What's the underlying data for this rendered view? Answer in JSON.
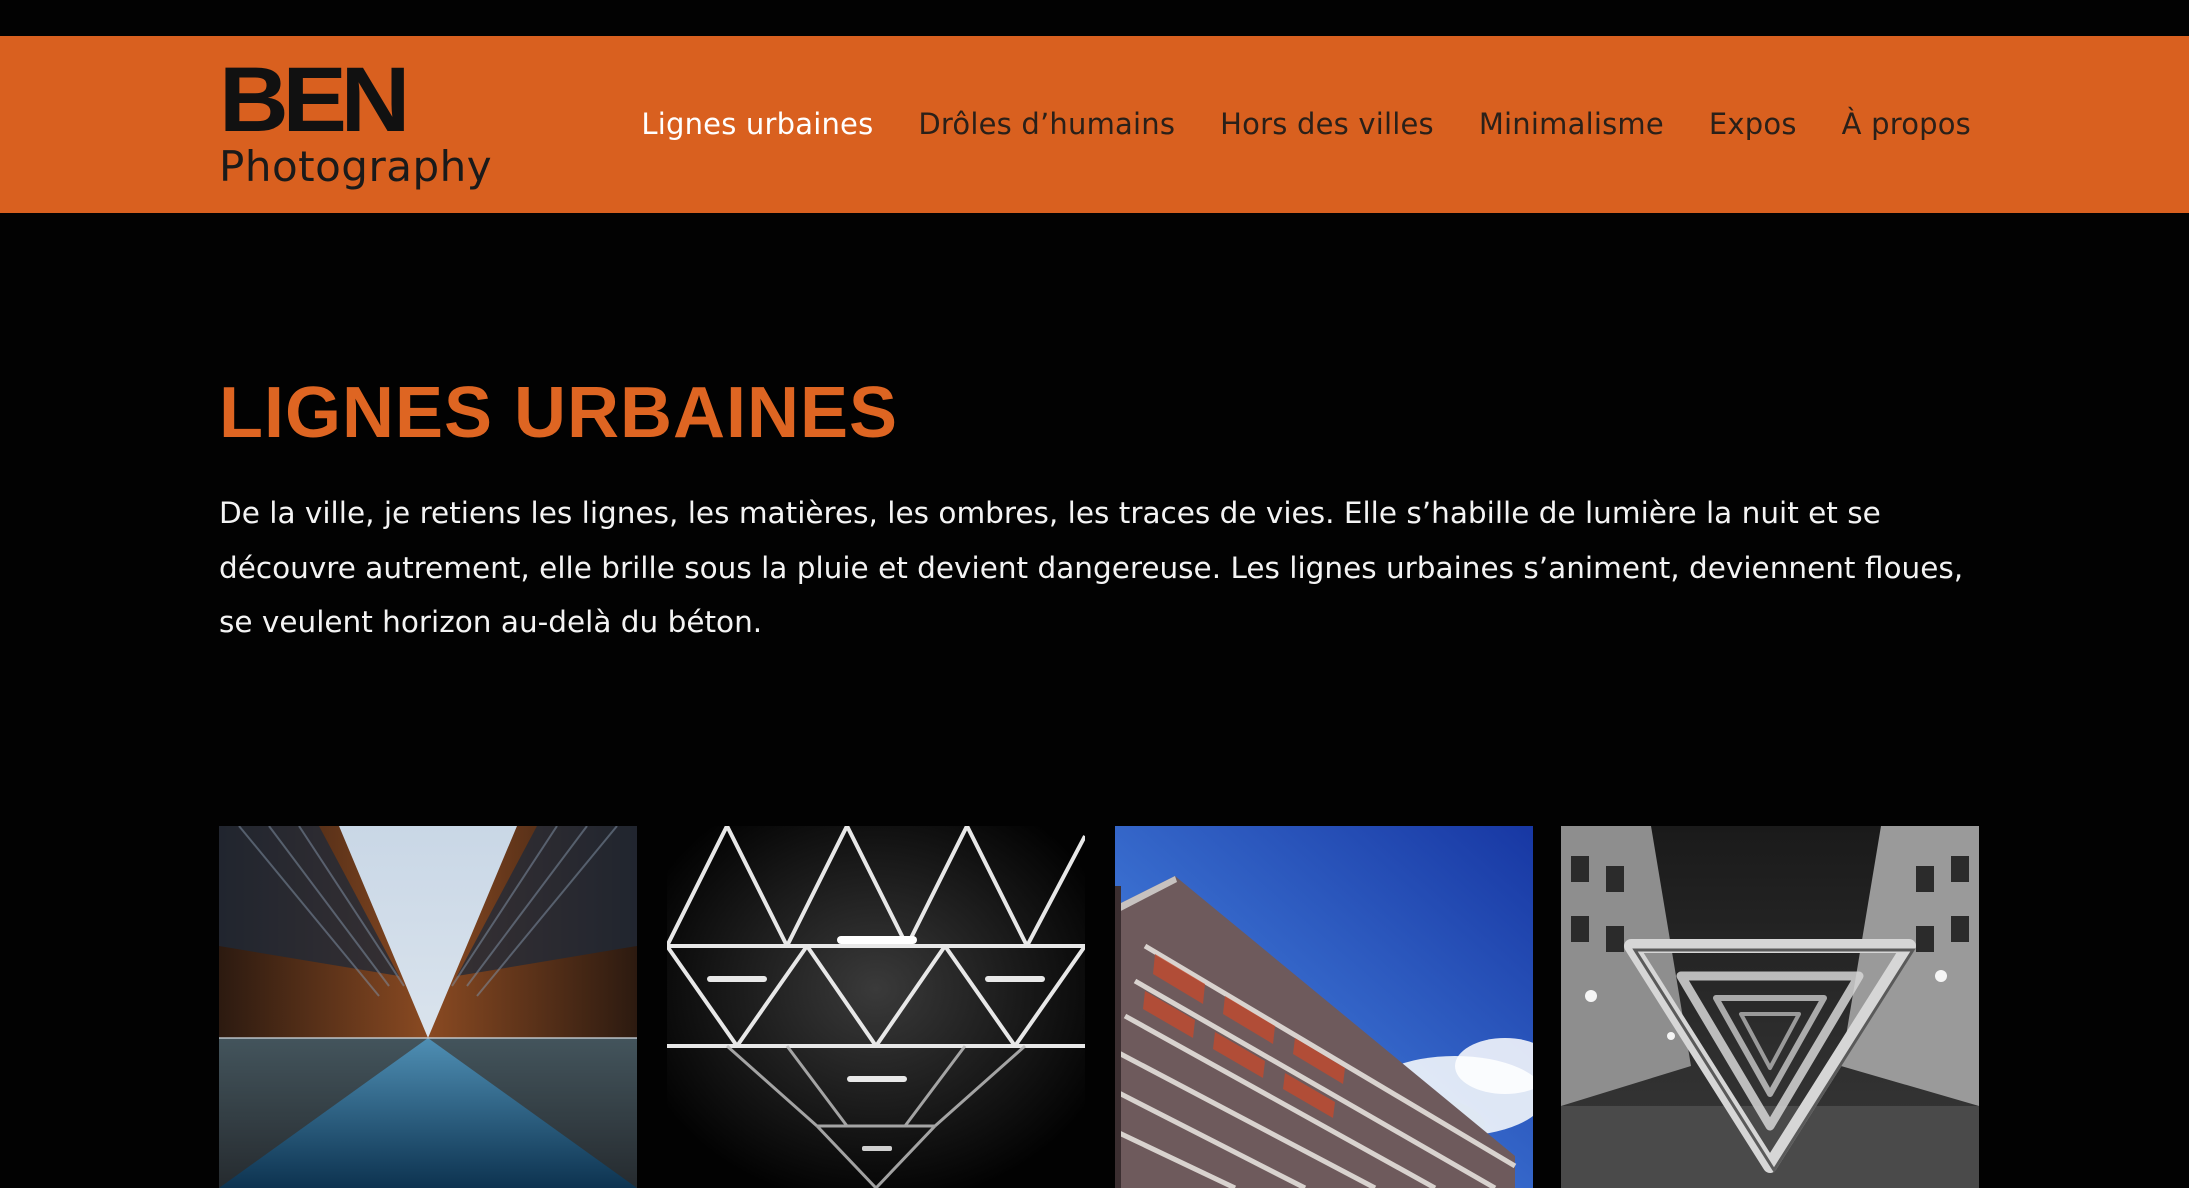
{
  "site": {
    "logo_mark": "BEN",
    "logo_sub": "Photography"
  },
  "nav": {
    "items": [
      {
        "label": "Lignes urbaines",
        "active": true
      },
      {
        "label": "Drôles d’humains",
        "active": false
      },
      {
        "label": "Hors des villes",
        "active": false
      },
      {
        "label": "Minimalisme",
        "active": false
      },
      {
        "label": "Expos",
        "active": false
      },
      {
        "label": "À propos",
        "active": false
      }
    ]
  },
  "main": {
    "title": "LIGNES URBAINES",
    "intro": "De la ville, je retiens les lignes, les matières, les ombres, les traces de vies. Elle s’habille de lumière la nuit et se découvre autrement, elle brille sous la pluie et devient dangereuse. Les lignes urbaines s’animent, deviennent floues, se veulent horizon au-delà du béton."
  },
  "gallery": {
    "photos": [
      {
        "subject": "symmetric-rusty-warehouses-reflected-in-water"
      },
      {
        "subject": "steel-truss-structure-lit-at-night-bw"
      },
      {
        "subject": "apartment-block-balconies-blue-sky"
      },
      {
        "subject": "triangular-bike-rack-night-street-bw"
      }
    ]
  },
  "colors": {
    "accent": "#d9601f",
    "title": "#de6522",
    "background": "#020202",
    "nav_text": "#2a2019",
    "nav_active": "#ffffff",
    "body_text": "#f4f4f4"
  }
}
